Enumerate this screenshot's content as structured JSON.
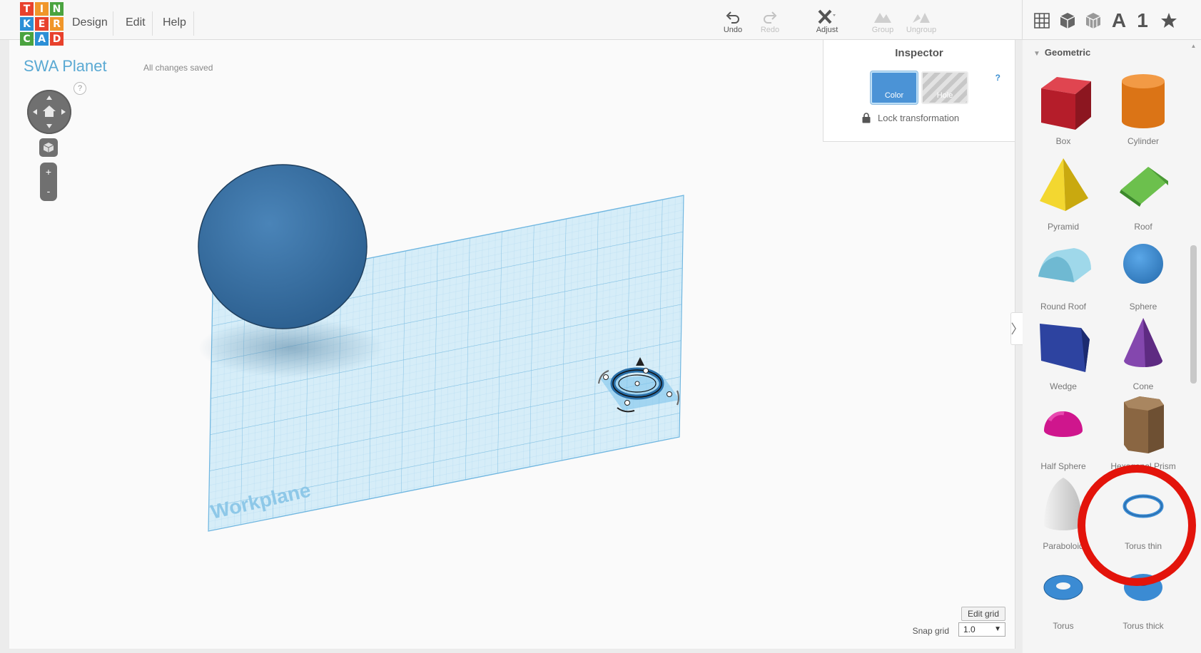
{
  "app": {
    "logo_letters": [
      "T",
      "I",
      "N",
      "K",
      "E",
      "R",
      "C",
      "A",
      "D"
    ],
    "logo_colors": [
      "#e8412c",
      "#f0962a",
      "#4aa33f",
      "#2c8fd6",
      "#e8412c",
      "#f0962a",
      "#4aa33f",
      "#2c8fd6",
      "#e8412c"
    ]
  },
  "menu": {
    "design": "Design",
    "edit": "Edit",
    "help": "Help"
  },
  "toolbar": {
    "undo": "Undo",
    "redo": "Redo",
    "adjust": "Adjust",
    "group": "Group",
    "ungroup": "Ungroup"
  },
  "view_toolbar": {
    "text_icon": "A",
    "number_icon": "1"
  },
  "project": {
    "title": "SWA Planet",
    "status": "All changes saved"
  },
  "viewcontrols": {
    "help": "?",
    "zoom_in": "+",
    "zoom_out": "-"
  },
  "workplane": {
    "label": "Workplane",
    "color": "#bfe0f2"
  },
  "inspector": {
    "title": "Inspector",
    "help": "?",
    "color_label": "Color",
    "hole_label": "Hole",
    "lock_label": "Lock transformation",
    "selected_color": "#4b93d6"
  },
  "grid": {
    "edit_label": "Edit grid",
    "snap_label": "Snap grid",
    "snap_value": "1.0"
  },
  "shapes_panel": {
    "header": "Geometric",
    "items": [
      {
        "label": "Box",
        "icon": "box-icon",
        "color": "#c8202e"
      },
      {
        "label": "Cylinder",
        "icon": "cylinder-icon",
        "color": "#e87d22"
      },
      {
        "label": "Pyramid",
        "icon": "pyramid-icon",
        "color": "#f2d11f"
      },
      {
        "label": "Roof",
        "icon": "roof-icon",
        "color": "#5aad3e"
      },
      {
        "label": "Round Roof",
        "icon": "round-roof-icon",
        "color": "#8fd0e4"
      },
      {
        "label": "Sphere",
        "icon": "sphere-icon",
        "color": "#3b8bd3"
      },
      {
        "label": "Wedge",
        "icon": "wedge-icon",
        "color": "#273c8c"
      },
      {
        "label": "Cone",
        "icon": "cone-icon",
        "color": "#7a3ea0"
      },
      {
        "label": "Half Sphere",
        "icon": "half-sphere-icon",
        "color": "#d11f92"
      },
      {
        "label": "Hexagonal Prism",
        "icon": "hexagonal-prism-icon",
        "color": "#8a6642"
      },
      {
        "label": "Paraboloid",
        "icon": "paraboloid-icon",
        "color": "#dedede"
      },
      {
        "label": "Torus thin",
        "icon": "torus-thin-icon",
        "color": "#3b8bd3"
      },
      {
        "label": "Torus",
        "icon": "torus-icon",
        "color": "#3b8bd3"
      },
      {
        "label": "Torus thick",
        "icon": "torus-thick-icon",
        "color": "#3b8bd3"
      }
    ]
  },
  "annotation": {
    "highlight_color": "#e3140b"
  }
}
